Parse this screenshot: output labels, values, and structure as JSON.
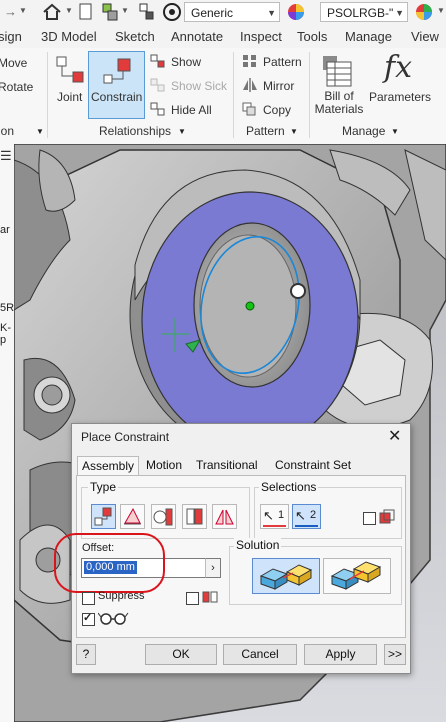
{
  "toolbar": {
    "appearance_combo": "Generic",
    "material_combo": "PSOLRGB-\""
  },
  "ribbon_tabs": [
    "sign",
    "3D Model",
    "Sketch",
    "Annotate",
    "Inspect",
    "Tools",
    "Manage",
    "View"
  ],
  "ribbon": {
    "position": {
      "move": "Move",
      "rotate": "Rotate",
      "panel_label": "ion"
    },
    "relationships": {
      "joint": "Joint",
      "constrain": "Constrain",
      "show": "Show",
      "show_sick": "Show Sick",
      "hide_all": "Hide All",
      "panel_label": "Relationships"
    },
    "pattern": {
      "pattern": "Pattern",
      "mirror": "Mirror",
      "copy": "Copy",
      "panel_label": "Pattern"
    },
    "manage": {
      "bom_line1": "Bill of",
      "bom_line2": "Materials",
      "parameters": "Parameters",
      "fx_glyph": "fx",
      "panel_label": "Manage"
    }
  },
  "browser_fragments": [
    "ar",
    "5R",
    "K-p"
  ],
  "dialog": {
    "title": "Place Constraint",
    "tabs": [
      "Assembly",
      "Motion",
      "Transitional",
      "Constraint Set"
    ],
    "active_tab": "Assembly",
    "type_label": "Type",
    "selections_label": "Selections",
    "selection_1": "1",
    "selection_2": "2",
    "offset_label": "Offset:",
    "offset_value": "0,000 mm",
    "solution_label": "Solution",
    "suppress_label": "Suppress",
    "buttons": {
      "ok": "OK",
      "cancel": "Cancel",
      "apply": "Apply",
      "more": ">>"
    },
    "highlight_color": "#d9141b"
  },
  "colors": {
    "face_highlight": "#7b7ad3",
    "selection_blue": "#1a87d8",
    "origin_point": "#14c414",
    "selected_tool": "#cfe3fa"
  }
}
